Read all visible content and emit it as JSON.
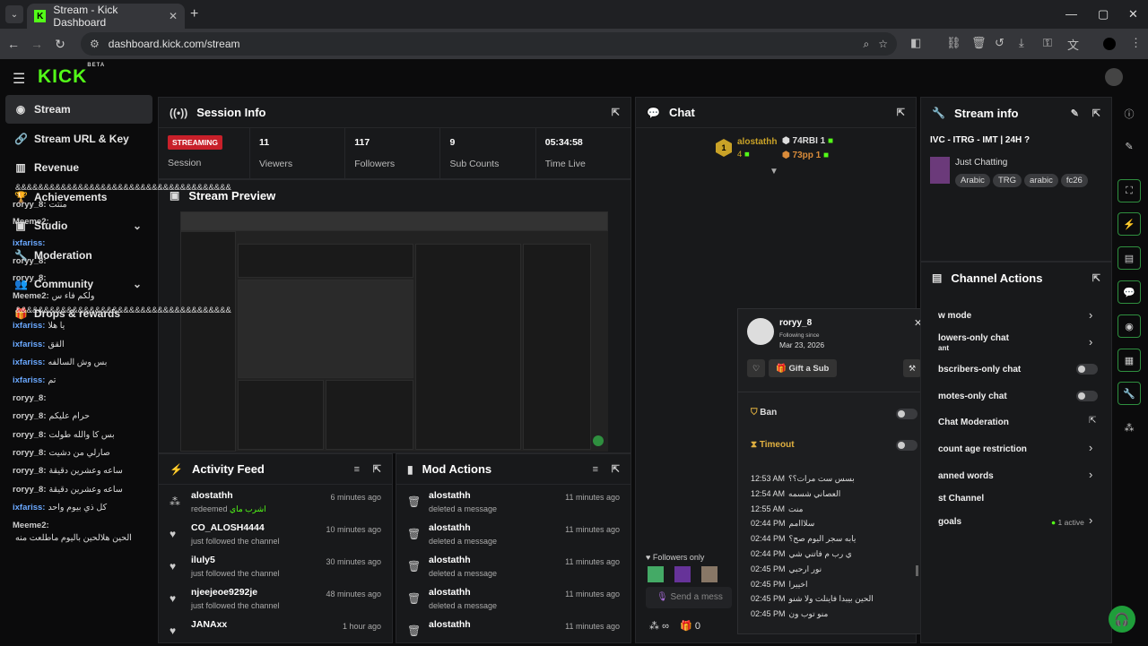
{
  "browser": {
    "tab_title": "Stream - Kick Dashboard",
    "url": "dashboard.kick.com/stream"
  },
  "app": {
    "logo": "KICK",
    "logo_sup": "BETA"
  },
  "sidebar": {
    "items": [
      {
        "label": "Stream",
        "icon": "stream-icon"
      },
      {
        "label": "Stream URL & Key",
        "icon": "link-icon"
      },
      {
        "label": "Revenue",
        "icon": "revenue-icon"
      },
      {
        "label": "Achievements",
        "icon": "trophy-icon"
      },
      {
        "label": "Studio",
        "icon": "studio-icon"
      },
      {
        "label": "Moderation",
        "icon": "wrench-icon"
      },
      {
        "label": "Community",
        "icon": "community-icon"
      },
      {
        "label": "Drops & rewards",
        "icon": "drops-icon"
      }
    ]
  },
  "session_info": {
    "title": "Session Info",
    "status_badge": "STREAMING",
    "stats": [
      {
        "value": "",
        "label": "Session"
      },
      {
        "value": "11",
        "label": "Viewers"
      },
      {
        "value": "117",
        "label": "Followers"
      },
      {
        "value": "9",
        "label": "Sub Counts"
      },
      {
        "value": "05:34:58",
        "label": "Time Live"
      }
    ]
  },
  "stream_preview": {
    "title": "Stream Preview"
  },
  "activity_feed": {
    "title": "Activity Feed",
    "items": [
      {
        "name": "alostathh",
        "sub": "redeemed",
        "extra": "اشرب ماي",
        "time": "6 minutes ago"
      },
      {
        "name": "CO_ALOSH4444",
        "sub": "just followed the channel",
        "extra": "",
        "time": "10 minutes ago"
      },
      {
        "name": "iluly5",
        "sub": "just followed the channel",
        "extra": "",
        "time": "30 minutes ago"
      },
      {
        "name": "njeejeoe9292je",
        "sub": "just followed the channel",
        "extra": "",
        "time": "48 minutes ago"
      },
      {
        "name": "JANAxx",
        "sub": "",
        "extra": "",
        "time": "1 hour ago"
      }
    ]
  },
  "mod_actions": {
    "title": "Mod Actions",
    "items": [
      {
        "name": "alostathh",
        "sub": "deleted a message",
        "time": "11 minutes ago"
      },
      {
        "name": "alostathh",
        "sub": "deleted a message",
        "time": "11 minutes ago"
      },
      {
        "name": "alostathh",
        "sub": "deleted a message",
        "time": "11 minutes ago"
      },
      {
        "name": "alostathh",
        "sub": "deleted a message",
        "time": "11 minutes ago"
      },
      {
        "name": "alostathh",
        "sub": "",
        "time": "11 minutes ago"
      }
    ]
  },
  "chat": {
    "title": "Chat",
    "pinned_user": "alostathh",
    "pinned_count": "4",
    "pinned_rank": "1",
    "leader1": "74RBI",
    "leader1_val": "1",
    "leader2": "73pp",
    "leader2_val": "1",
    "messages": [
      {
        "user": "",
        "text": "&&&&&&&&&&&&&&&&&&&&&&&&&&&&&&&&&&&&&&",
        "blue": false
      },
      {
        "user": "roryy_8:",
        "text": "منتت",
        "blue": false
      },
      {
        "user": "Meeme2:",
        "text": "",
        "blue": false
      },
      {
        "user": "ixfariss:",
        "text": "",
        "blue": true
      },
      {
        "user": "roryy_8:",
        "text": "",
        "blue": false
      },
      {
        "user": "roryy_8:",
        "text": "",
        "blue": false
      },
      {
        "user": "Meeme2:",
        "text": "ولكم فاء س",
        "blue": false
      },
      {
        "user": "",
        "text": "&&&&&&&&&&&&&&&&&&&&&&&&&&&&&&&&&&&&&&",
        "blue": false
      },
      {
        "user": "ixfariss:",
        "text": "يا هلا",
        "blue": true
      },
      {
        "user": "ixfariss:",
        "text": "القق",
        "blue": true
      },
      {
        "user": "ixfariss:",
        "text": "بس وش السالفه",
        "blue": true
      },
      {
        "user": "ixfariss:",
        "text": "تم",
        "blue": true
      },
      {
        "user": "roryy_8:",
        "text": "",
        "blue": false
      },
      {
        "user": "roryy_8:",
        "text": "حرام عليكم",
        "blue": false
      },
      {
        "user": "roryy_8:",
        "text": "بس كا والله طولت",
        "blue": false
      },
      {
        "user": "roryy_8:",
        "text": "صارلي من دشيت",
        "blue": false
      },
      {
        "user": "roryy_8:",
        "text": "ساعه وعشرين دقيقة",
        "blue": false
      },
      {
        "user": "roryy_8:",
        "text": "ساعه وعشرين دقيقة",
        "blue": false
      },
      {
        "user": "ixfariss:",
        "text": "كل ذي بيوم واحد",
        "blue": true
      },
      {
        "user": "Meeme2:",
        "text": "",
        "blue": false
      },
      {
        "user": "",
        "text": "الحين هلالحين باليوم ماطلعت منه",
        "blue": false
      }
    ],
    "followers_only": "Followers only",
    "send_placeholder": "Send a mess",
    "footer_count": "0",
    "footer_infinity": "∞"
  },
  "user_popup": {
    "username": "roryy_8",
    "following_since_label": "Following since",
    "following_since": "Mar 23, 2026",
    "gift_label": "Gift a Sub",
    "ban_label": "Ban",
    "timeout_label": "Timeout",
    "history": [
      {
        "time": "12:53 AM",
        "text": "بسس ست مرات؟؟"
      },
      {
        "time": "12:54 AM",
        "text": "العصاني شسمه"
      },
      {
        "time": "12:55 AM",
        "text": "منت"
      },
      {
        "time": "02:44 PM",
        "text": "سلااامم"
      },
      {
        "time": "02:44 PM",
        "text": "يابه سجر اليوم صح؟"
      },
      {
        "time": "02:44 PM",
        "text": "ي رب م فاتني شي"
      },
      {
        "time": "02:45 PM",
        "text": "نور ارحبي"
      },
      {
        "time": "02:45 PM",
        "text": "اخييرا"
      },
      {
        "time": "02:45 PM",
        "text": "الحين بيبدا فاينلت ولا شنو"
      },
      {
        "time": "02:45 PM",
        "text": "منو توب ون"
      }
    ]
  },
  "stream_info": {
    "title": "Stream info",
    "stream_title": "IVC - ITRG - IMT | 24H ?",
    "category": "Just Chatting",
    "tags": [
      "Arabic",
      "TRG",
      "arabic",
      "fc26"
    ]
  },
  "channel_actions": {
    "title": "Channel Actions",
    "items": [
      {
        "label": "w mode",
        "extra": "",
        "control": "chevron"
      },
      {
        "label": "lowers-only chat",
        "extra": "ant",
        "control": "chevron"
      },
      {
        "label": "bscribers-only chat",
        "extra": "",
        "control": "toggle"
      },
      {
        "label": "motes-only chat",
        "extra": "",
        "control": "toggle"
      },
      {
        "label": "Chat Moderation",
        "extra": "",
        "control": "popout"
      },
      {
        "label": "count age restriction",
        "extra": "",
        "control": "chevron"
      },
      {
        "label": "anned words",
        "extra": "",
        "control": "chevron"
      },
      {
        "label": "st Channel",
        "extra": "",
        "control": "none"
      },
      {
        "label": "goals",
        "extra": "1 active",
        "control": "chevron"
      }
    ]
  }
}
